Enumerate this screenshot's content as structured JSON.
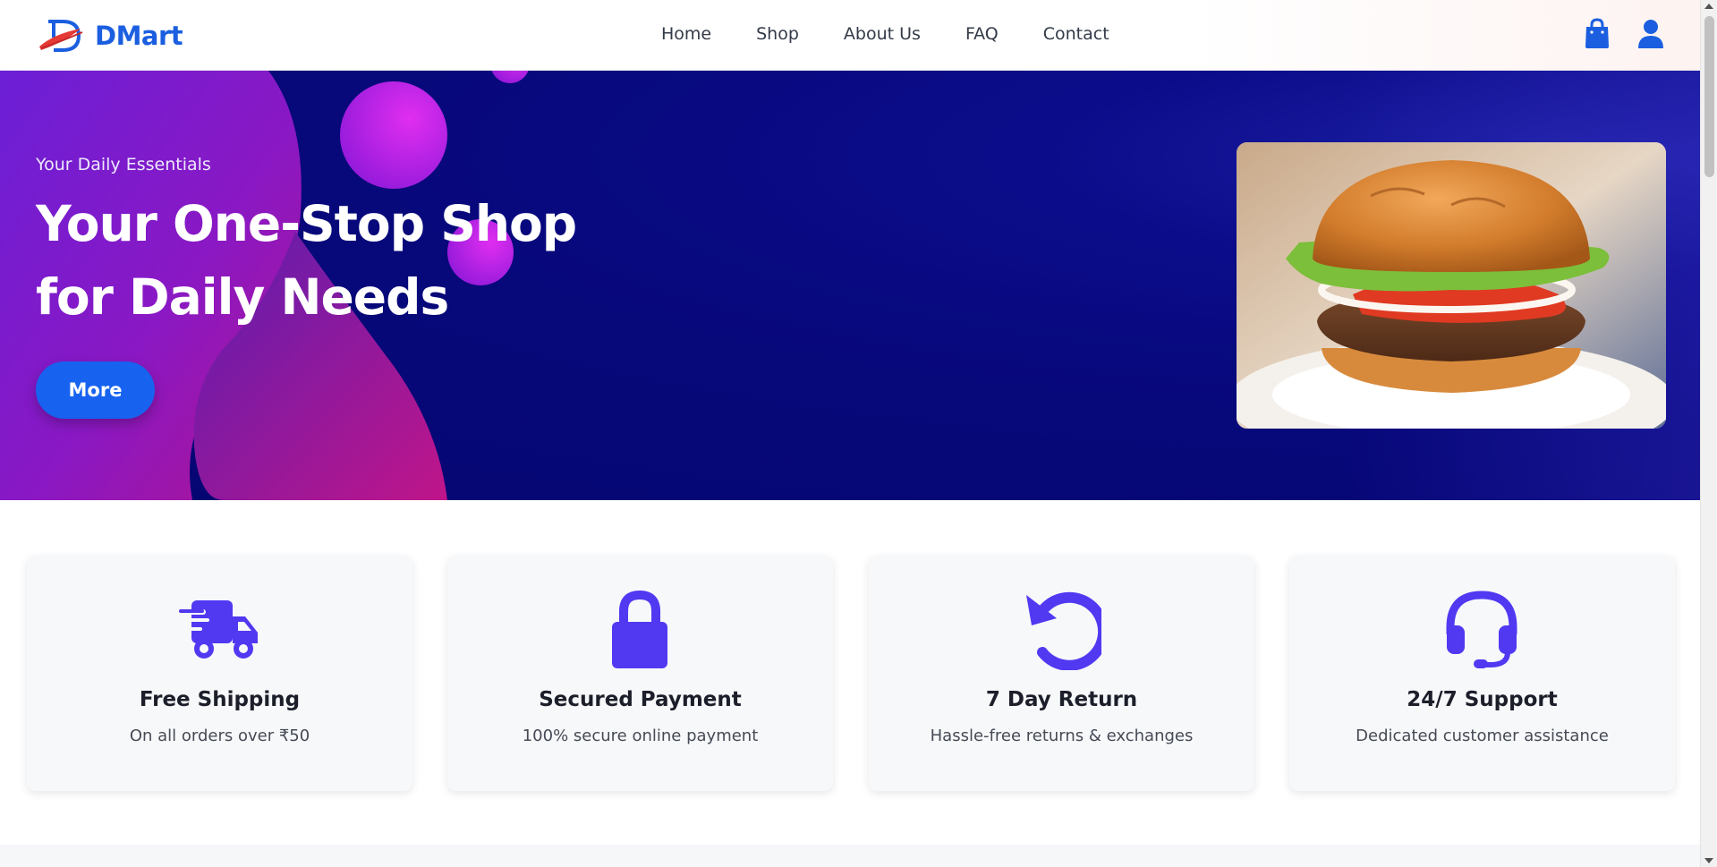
{
  "brand": {
    "name": "DMart"
  },
  "nav": {
    "links": [
      "Home",
      "Shop",
      "About Us",
      "FAQ",
      "Contact"
    ],
    "icons": [
      "shopping-bag-icon",
      "user-icon"
    ]
  },
  "hero": {
    "subtitle": "Your Daily Essentials",
    "title": "Your One-Stop Shop for Daily Needs",
    "button_label": "More",
    "image": "burger-image"
  },
  "features": [
    {
      "icon": "truck-icon",
      "title": "Free Shipping",
      "description": "On all orders over ₹50"
    },
    {
      "icon": "lock-icon",
      "title": "Secured Payment",
      "description": "100% secure online payment"
    },
    {
      "icon": "undo-icon",
      "title": "7 Day Return",
      "description": "Hassle-free returns & exchanges"
    },
    {
      "icon": "headset-icon",
      "title": "24/7 Support",
      "description": "Dedicated customer assistance"
    }
  ],
  "colors": {
    "brand_blue": "#1b5fe0",
    "button_blue": "#1763f0",
    "hero_navy": "#07087a",
    "accent_purple": "#c21fe8",
    "icon_indigo": "#5139f2"
  }
}
